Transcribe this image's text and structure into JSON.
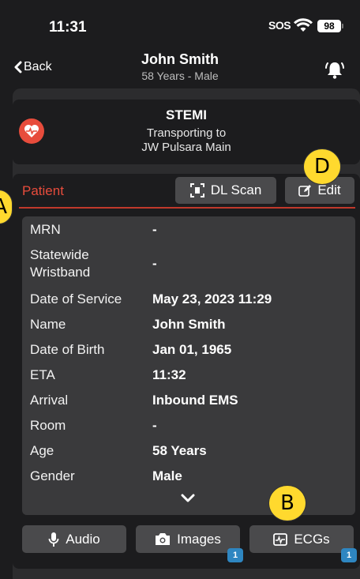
{
  "status_bar": {
    "time": "11:31",
    "sos": "SOS",
    "battery": "98"
  },
  "nav": {
    "back_label": "Back",
    "title": "John Smith",
    "subtitle": "58 Years - Male"
  },
  "alert": {
    "type": "STEMI",
    "line1": "Transporting to",
    "line2": "JW Pulsara Main"
  },
  "patient": {
    "header": "Patient",
    "dl_scan_label": "DL Scan",
    "edit_label": "Edit",
    "fields": [
      {
        "label": "MRN",
        "value": "-"
      },
      {
        "label": "Statewide",
        "label2": "Wristband",
        "value": "-"
      },
      {
        "label": "Date of Service",
        "value": "May 23, 2023 11:29"
      },
      {
        "label": "Name",
        "value": "John Smith"
      },
      {
        "label": "Date of Birth",
        "value": "Jan 01, 1965"
      },
      {
        "label": "ETA",
        "value": "11:32"
      },
      {
        "label": "Arrival",
        "value": "Inbound EMS"
      },
      {
        "label": "Room",
        "value": "-"
      },
      {
        "label": "Age",
        "value": "58 Years"
      },
      {
        "label": "Gender",
        "value": "Male"
      }
    ]
  },
  "media": {
    "audio_label": "Audio",
    "images_label": "Images",
    "images_count": "1",
    "ecgs_label": "ECGs",
    "ecgs_count": "1"
  },
  "markers": {
    "a": "A",
    "b": "B",
    "d": "D"
  }
}
